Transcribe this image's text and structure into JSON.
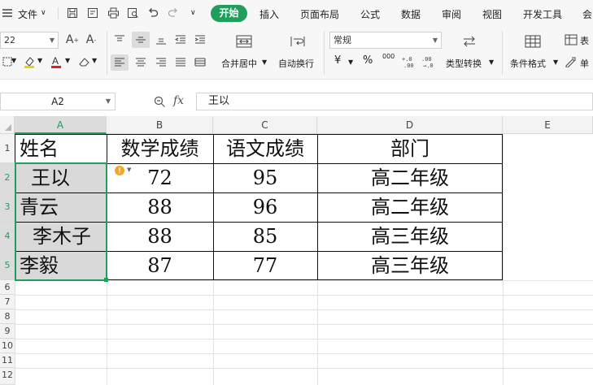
{
  "menubar": {
    "file": "文件",
    "tabs": [
      "开始",
      "插入",
      "页面布局",
      "公式",
      "数据",
      "审阅",
      "视图",
      "开发工具",
      "会"
    ]
  },
  "ribbon": {
    "font_size": "22",
    "merge_center": "合并居中",
    "wrap_text": "自动换行",
    "number_format": "常规",
    "currency_symbol": "¥",
    "percent": "%",
    "thousands": "000",
    "type_convert": "类型转换",
    "cond_format": "条件格式",
    "table_label": "表",
    "cell_label": "单"
  },
  "formula_bar": {
    "name_box": "A2",
    "fx": "fx",
    "value": "王以"
  },
  "columns": [
    "A",
    "B",
    "C",
    "D",
    "E"
  ],
  "rows": [
    "1",
    "2",
    "3",
    "4",
    "5",
    "6",
    "7",
    "8",
    "9",
    "10",
    "11",
    "12"
  ],
  "table": {
    "headers": [
      "姓名",
      "数学成绩",
      "语文成绩",
      "部门"
    ],
    "rows": [
      [
        "王以",
        "72",
        "95",
        "高二年级"
      ],
      [
        "青云",
        "88",
        "96",
        "高二年级"
      ],
      [
        "李木子",
        "88",
        "85",
        "高三年级"
      ],
      [
        "李毅",
        "87",
        "77",
        "高三年级"
      ]
    ]
  },
  "colors": {
    "accent": "#1f9e5c",
    "selection": "#d9d9d9",
    "warning": "#f5a623"
  }
}
